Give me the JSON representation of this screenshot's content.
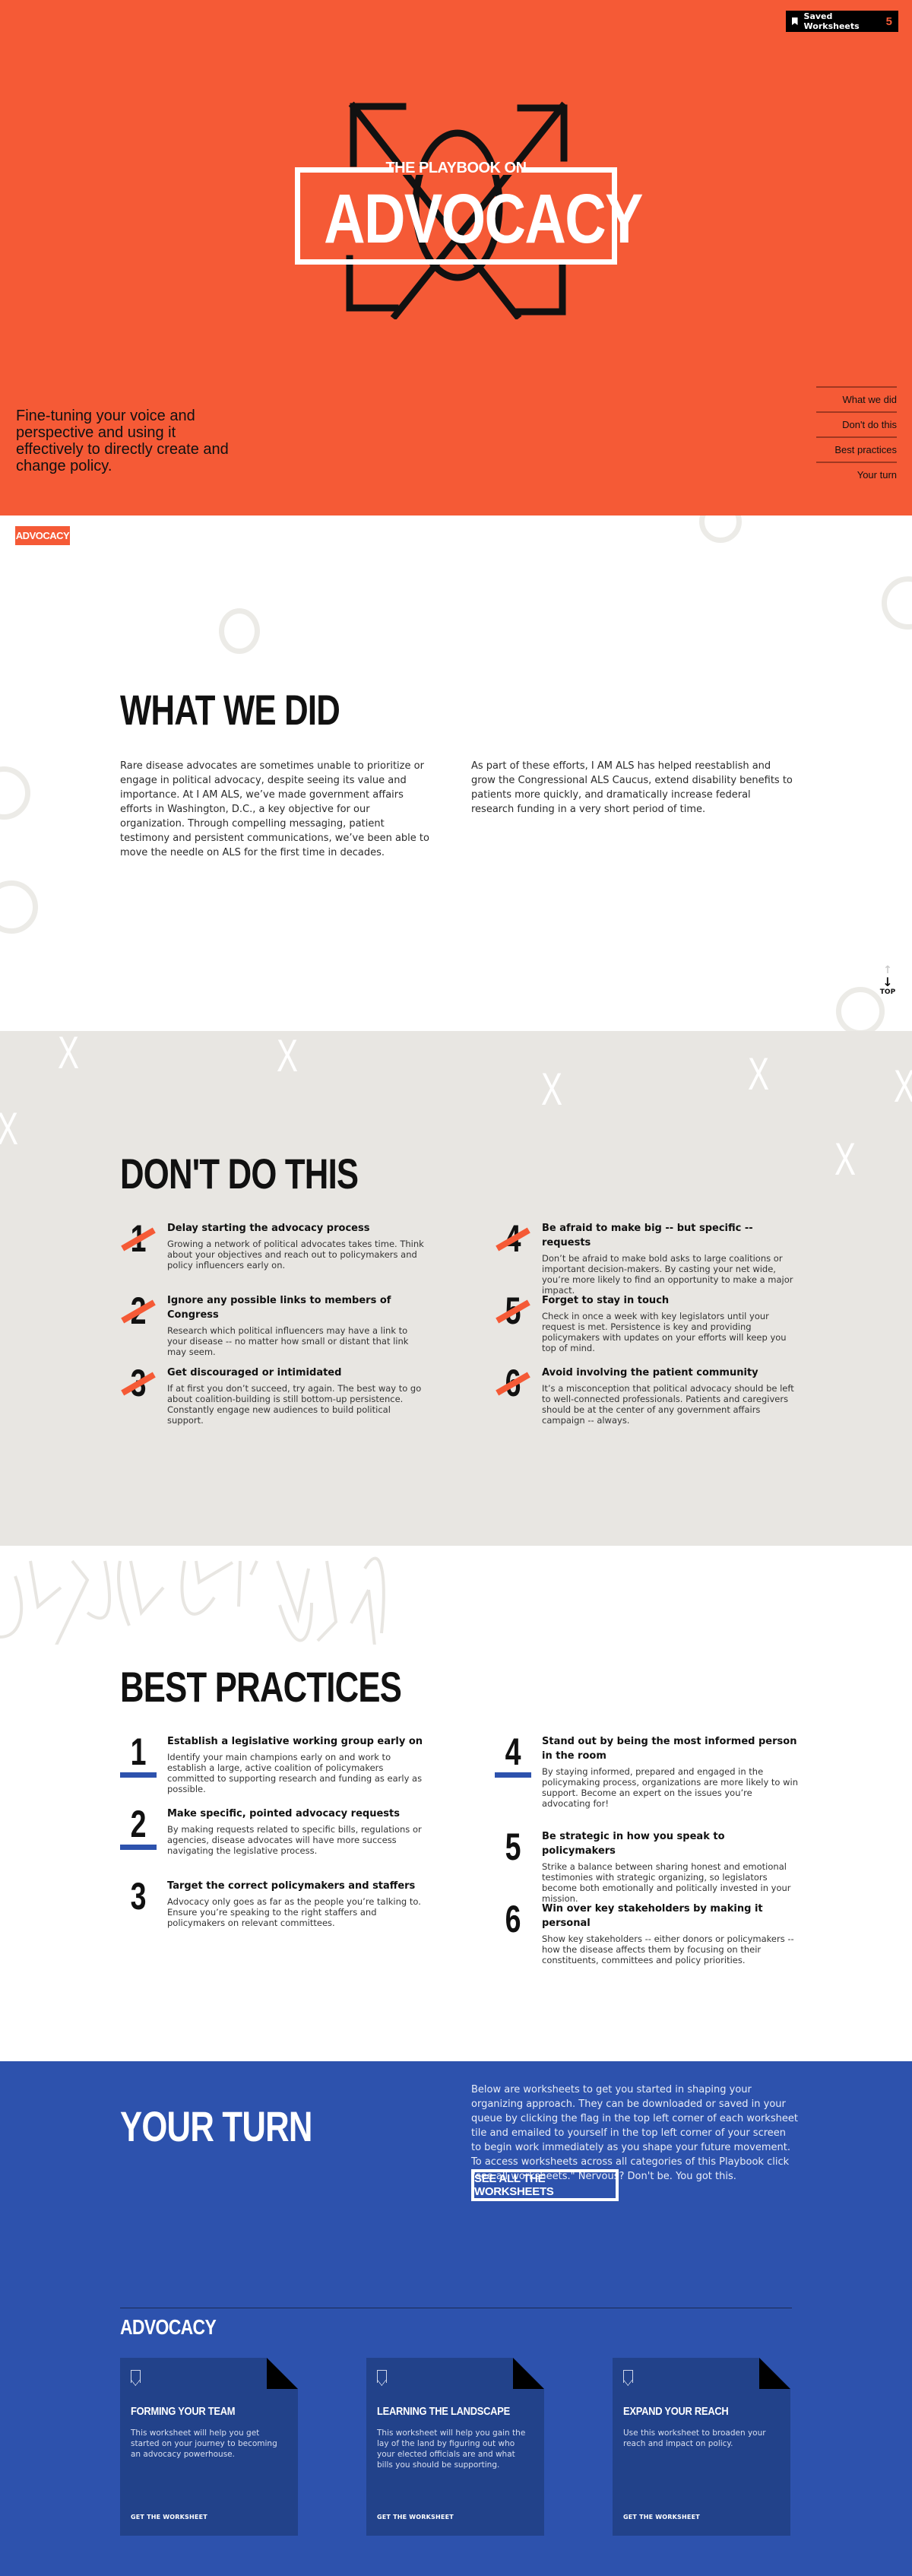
{
  "header": {
    "saved_worksheets_label": "Saved Worksheets",
    "saved_worksheets_count": "5",
    "logo_pretitle": "THE PLAYBOOK ON",
    "logo_title": "ADVOCACY",
    "tagline": "Fine-tuning your voice and perspective and using it effectively to directly create and change policy.",
    "nav": [
      {
        "label": "What we did"
      },
      {
        "label": "Don't do this"
      },
      {
        "label": "Best practices"
      },
      {
        "label": "Your turn"
      }
    ]
  },
  "section_tag": "ADVOCACY",
  "what_we_did": {
    "title": "WHAT WE DID",
    "left": "Rare disease advocates are sometimes unable to prioritize or engage in political advocacy, despite seeing its value and importance. At I AM ALS, we’ve made government affairs efforts in Washington, D.C., a key objective for our organization. Through compelling messaging, patient testimony and persistent communications, we’ve been able to move the needle  on ALS for the first time in decades.",
    "right": "As part of these efforts, I AM ALS has helped reestablish and grow the Congressional ALS Caucus, extend disability benefits to patients more quickly, and dramatically increase federal research funding in a very short period of time.",
    "top_label": "TOP"
  },
  "dont_do_this": {
    "title": "DON'T DO THIS",
    "items": [
      {
        "num": "1",
        "title": "Delay starting the advocacy process",
        "body": "Growing a network of political advocates takes time. Think about your objectives and reach out to policymakers and policy influencers early on."
      },
      {
        "num": "2",
        "title": "Ignore any possible links to members of Congress",
        "body": "Research which political influencers may have a link to your disease -- no matter how small or distant that link may seem."
      },
      {
        "num": "3",
        "title": "Get discouraged or intimidated",
        "body": "If at first you don’t succeed, try again. The best way to go about coalition-building is still bottom-up persistence. Constantly engage new audiences to build political support."
      },
      {
        "num": "4",
        "title": "Be afraid to make big -- but specific -- requests",
        "body": "Don’t be afraid to make bold asks to large coalitions or important decision-makers. By casting your net wide, you’re more likely to find an opportunity to make a major impact."
      },
      {
        "num": "5",
        "title": "Forget to stay in touch",
        "body": "Check in once a week with key legislators until your request is met. Persistence is key and providing policymakers with updates on your efforts will keep you top of mind."
      },
      {
        "num": "6",
        "title": "Avoid involving the patient community",
        "body": "It’s a misconception that political advocacy should be left to well-connected professionals. Patients and caregivers should be at the center of any government affairs campaign -- always."
      }
    ]
  },
  "best_practices": {
    "title": "BEST PRACTICES",
    "items": [
      {
        "num": "1",
        "title": "Establish a legislative working group early on",
        "body": "Identify your main champions early on and work to establish a large, active coalition of policymakers committed to supporting research and funding as early as possible."
      },
      {
        "num": "2",
        "title": "Make specific, pointed advocacy requests",
        "body": "By making requests related to specific bills, regulations or agencies, disease advocates will have more success navigating the legislative process."
      },
      {
        "num": "3",
        "title": "Target the correct policymakers and staffers",
        "body": "Advocacy only goes as far as the people you’re talking to. Ensure you’re speaking to the right staffers and policymakers on relevant committees."
      },
      {
        "num": "4",
        "title": "Stand out by being the most informed person in the room",
        "body": "By staying informed, prepared and engaged in the policymaking process, organizations are more likely to win support. Become an expert on the issues you’re advocating for!"
      },
      {
        "num": "5",
        "title": "Be strategic in how you speak to policymakers",
        "body": "Strike a balance between sharing honest and emotional testimonies with strategic organizing, so legislators become both emotionally and politically invested in your mission."
      },
      {
        "num": "6",
        "title": "Win over key stakeholders by making it personal",
        "body": "Show key stakeholders -- either donors or policymakers -- how the disease affects them by focusing on their constituents, committees and policy priorities."
      }
    ]
  },
  "your_turn": {
    "title": "YOUR TURN",
    "intro": "Below are worksheets to get you started in shaping your organizing approach. They can be downloaded or saved in your queue by clicking the flag in the top left corner of each worksheet tile and emailed to yourself in the top left corner of your screen to begin work immediately as you shape your future movement. To access worksheets across all categories of this Playbook click \"see all worksheets.\" Nervous? Don't be. You got this.",
    "see_all_label": "SEE ALL THE WORKSHEETS",
    "category": "ADVOCACY",
    "cards": [
      {
        "title": "FORMING YOUR TEAM",
        "body": "This worksheet will help you get started on your journey to becoming an advocacy powerhouse.",
        "cta": "GET THE WORKSHEET"
      },
      {
        "title": "LEARNING THE LANDSCAPE",
        "body": "This worksheet will help you gain the lay of the land by figuring out who your elected officials are and what bills you should be supporting.",
        "cta": "GET THE WORKSHEET"
      },
      {
        "title": "EXPAND YOUR REACH",
        "body": "Use this worksheet to broaden your reach and impact on policy.",
        "cta": "GET THE WORKSHEET"
      }
    ]
  },
  "colors": {
    "brand_orange": "#f55a36",
    "brand_blue": "#2d52ad",
    "card_blue": "#22428a",
    "light_gray": "#e8e6e2"
  }
}
